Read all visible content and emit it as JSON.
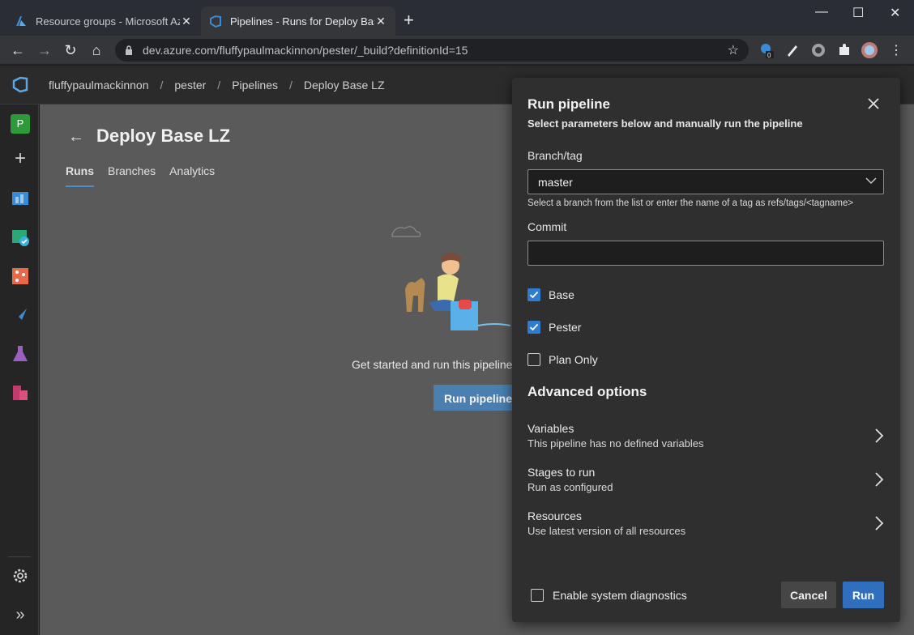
{
  "browser": {
    "tabs": [
      {
        "title": "Resource groups - Microsoft Azu"
      },
      {
        "title": "Pipelines - Runs for Deploy Base"
      }
    ],
    "url": "dev.azure.com/fluffypaulmackinnon/pester/_build?definitionId=15",
    "extension_badge": "0"
  },
  "header": {
    "breadcrumbs": [
      "fluffypaulmackinnon",
      "pester",
      "Pipelines",
      "Deploy Base LZ"
    ]
  },
  "sidebar": {
    "project_initial": "P"
  },
  "page": {
    "title": "Deploy Base LZ",
    "tabs": [
      "Runs",
      "Branches",
      "Analytics"
    ],
    "empty_message": "Get started and run this pipeline",
    "run_button": "Run pipeline"
  },
  "panel": {
    "title": "Run pipeline",
    "subtitle": "Select parameters below and manually run the pipeline",
    "branch_label": "Branch/tag",
    "branch_value": "master",
    "branch_hint": "Select a branch from the list or enter the name of a tag as refs/tags/<tagname>",
    "commit_label": "Commit",
    "commit_value": "",
    "parameters": [
      {
        "label": "Base",
        "checked": true
      },
      {
        "label": "Pester",
        "checked": true
      },
      {
        "label": "Plan Only",
        "checked": false
      }
    ],
    "advanced_title": "Advanced options",
    "advanced": [
      {
        "title": "Variables",
        "subtitle": "This pipeline has no defined variables"
      },
      {
        "title": "Stages to run",
        "subtitle": "Run as configured"
      },
      {
        "title": "Resources",
        "subtitle": "Use latest version of all resources"
      }
    ],
    "diagnostics_label": "Enable system diagnostics",
    "cancel_label": "Cancel",
    "run_label": "Run"
  }
}
